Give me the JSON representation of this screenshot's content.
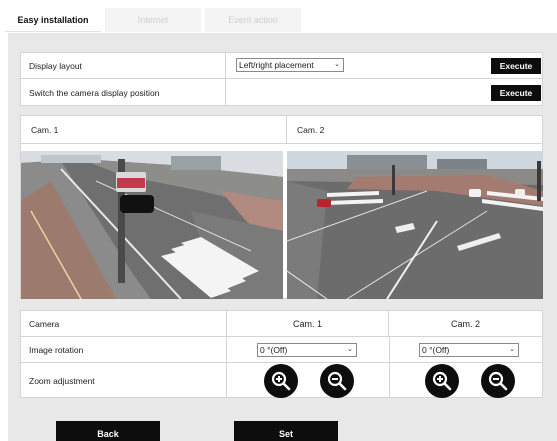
{
  "tabs": [
    {
      "label": "Easy installation"
    },
    {
      "label": "Internet"
    },
    {
      "label": "Event action"
    }
  ],
  "settings": {
    "display_layout_label": "Display layout",
    "display_layout_value": "Left/right placement",
    "execute_label": "Execute",
    "switch_label": "Switch the camera display position",
    "execute2_label": "Execute"
  },
  "cameras": {
    "cam1_title": "Cam. 1",
    "cam2_title": "Cam. 2"
  },
  "table": {
    "camera_label": "Camera",
    "cam1": "Cam. 1",
    "cam2": "Cam. 2",
    "rotation_label": "Image rotation",
    "rotation_cam1": "0 °(Off)",
    "rotation_cam2": "0 °(Off)",
    "zoom_label": "Zoom adjustment"
  },
  "icons": {
    "zoom_in": "zoom-in-icon",
    "zoom_out": "zoom-out-icon",
    "dropdown": "chevron-down-icon"
  },
  "footer": {
    "back_label": "Back",
    "set_label": "Set"
  },
  "colors": {
    "button_bg": "#0d0d0d",
    "panel_bg": "#e8e8e8"
  }
}
